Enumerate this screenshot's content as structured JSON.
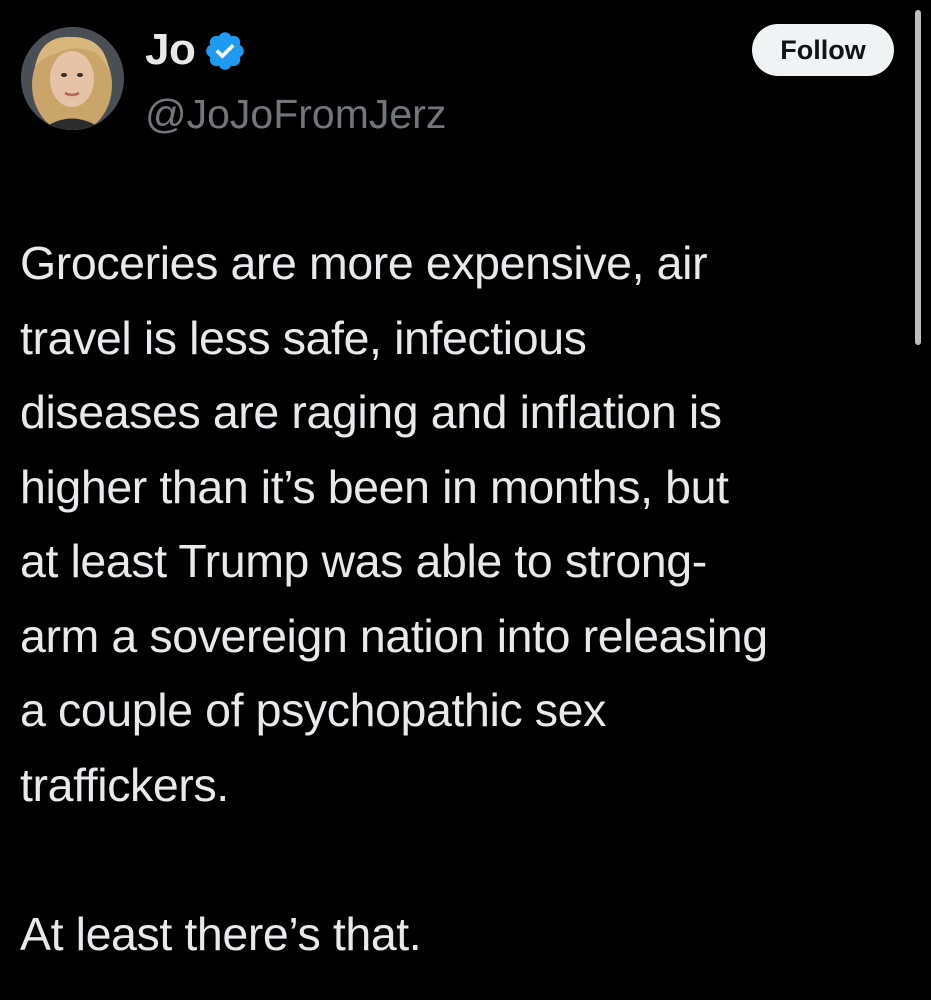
{
  "author": {
    "display_name": "Jo",
    "handle": "@JoJoFromJerz",
    "verified_icon": "verified-badge-icon",
    "avatar_icon": "avatar-photo"
  },
  "actions": {
    "follow_label": "Follow"
  },
  "tweet": {
    "paragraph_1": "Groceries are more expensive, air\ntravel is less safe, infectious\ndiseases are raging and inflation is\nhigher than it’s been in months, but\nat least Trump was able to strong-\narm a sovereign nation into releasing\na couple of psychopathic sex\ntraffickers.",
    "paragraph_2": "At least there’s that."
  },
  "colors": {
    "background": "#000000",
    "text": "#e7e9ea",
    "secondary_text": "#71767b",
    "verified_blue": "#1d9bf0",
    "follow_button_bg": "#eff3f4"
  }
}
